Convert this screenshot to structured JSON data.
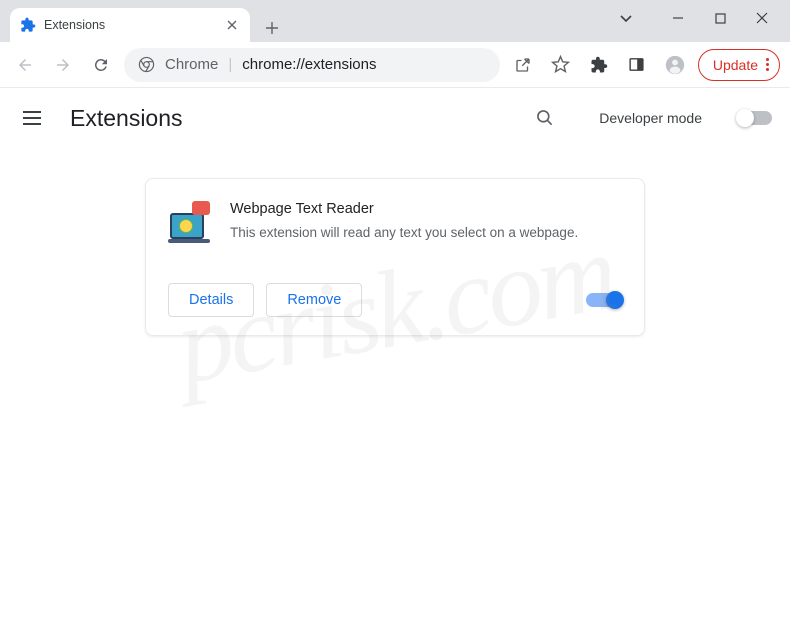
{
  "titlebar": {
    "tab_title": "Extensions"
  },
  "toolbar": {
    "omni_label": "Chrome",
    "omni_url": "chrome://extensions",
    "update_label": "Update"
  },
  "header": {
    "title": "Extensions",
    "dev_mode_label": "Developer mode"
  },
  "extension": {
    "name": "Webpage Text Reader",
    "description": "This extension will read any text you select on a webpage.",
    "details_label": "Details",
    "remove_label": "Remove"
  },
  "watermark": "pcrisk.com"
}
